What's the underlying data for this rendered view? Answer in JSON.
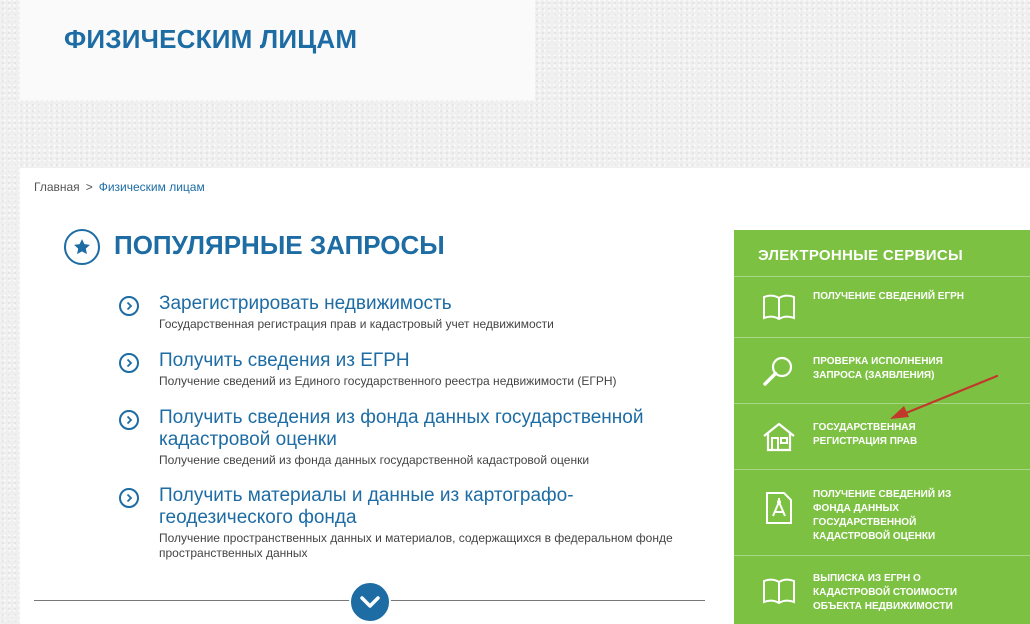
{
  "header": {
    "title": "ФИЗИЧЕСКИМ ЛИЦАМ"
  },
  "breadcrumb": {
    "home": "Главная",
    "separator": ">",
    "current": "Физическим лицам"
  },
  "section": {
    "title": "ПОПУЛЯРНЫЕ ЗАПРОСЫ",
    "icon": "star-icon"
  },
  "requests": [
    {
      "title": "Зарегистрировать недвижимость",
      "description": "Государственная регистрация прав и кадастровый учет недвижимости"
    },
    {
      "title": "Получить сведения из ЕГРН",
      "description": "Получение сведений из Единого государственного реестра недвижимости (ЕГРН)"
    },
    {
      "title": "Получить сведения из фонда данных государственной кадастровой оценки",
      "description": "Получение сведений из фонда данных государственной кадастровой оценки"
    },
    {
      "title": "Получить материалы и данные из картографо-геодезического фонда",
      "description": "Получение пространственных данных и материалов, содержащихся в федеральном фонде пространственных данных"
    }
  ],
  "more_button": {
    "icon": "chevron-down-icon"
  },
  "services": {
    "title": "ЭЛЕКТРОННЫЕ СЕРВИСЫ",
    "items": [
      {
        "label": "ПОЛУЧЕНИЕ СВЕДЕНИЙ ЕГРН",
        "icon": "book-icon"
      },
      {
        "label": "ПРОВЕРКА ИСПОЛНЕНИЯ\nЗАПРОСА (ЗАЯВЛЕНИЯ)",
        "icon": "magnifier-icon"
      },
      {
        "label": "ГОСУДАРСТВЕННАЯ\nРЕГИСТРАЦИЯ ПРАВ",
        "icon": "house-icon"
      },
      {
        "label": "ПОЛУЧЕНИЕ СВЕДЕНИЙ ИЗ\nФОНДА ДАННЫХ\nГОСУДАРСТВЕННОЙ\nКАДАСТРОВОЙ ОЦЕНКИ",
        "icon": "compass-document-icon"
      },
      {
        "label": "ВЫПИСКА ИЗ ЕГРН О\nКАДАСТРОВОЙ СТОИМОСТИ\nОБЪЕКТА НЕДВИЖИМОСТИ",
        "icon": "book-icon"
      }
    ]
  },
  "colors": {
    "brand_blue": "#1d6ca4",
    "services_green": "#7cc142",
    "arrow_red": "#c0392b"
  }
}
